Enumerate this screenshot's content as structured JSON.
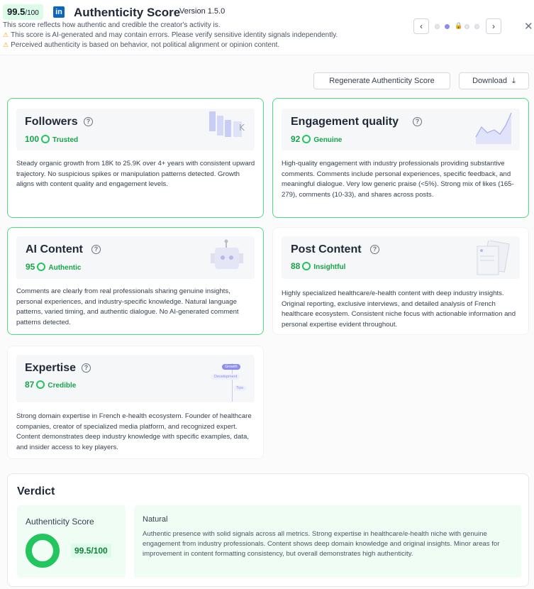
{
  "header": {
    "score": "99.5",
    "score_max": "/100",
    "linkedin_icon": "linkedin-icon",
    "title": "Authenticity Score",
    "version": "Version 1.5.0",
    "subtitle": "This score reflects how authentic and credible the creator's activity is.",
    "warnings": [
      "This score is AI-generated and may contain errors. Please verify sensitive identity signals independently.",
      "Perceived authenticity is based on behavior, not political alignment or opinion content."
    ],
    "pager": {
      "prev_icon": "chevron-left-icon",
      "next_icon": "chevron-right-icon",
      "active_dot": 2,
      "dot_count": 5
    },
    "close_icon": "close-icon"
  },
  "actions": {
    "regenerate_label": "Regenerate Authenticity Score",
    "download_label": "Download"
  },
  "colors": {
    "accent_green": "#22c55e",
    "pill_green": "#dcfce7",
    "linkedin_blue": "#0a66c2",
    "active_dot": "#8b8cf0"
  },
  "cards": {
    "followers": {
      "title": "Followers",
      "score": "100",
      "status": "Trusted",
      "description": "Steady organic growth from 18K to 25.9K over 4+ years with consistent upward trajectory. No suspicious spikes or manipulation patterns detected. Growth aligns with content quality and engagement levels."
    },
    "engagement": {
      "title": "Engagement quality",
      "score": "92",
      "status": "Genuine",
      "description": "High-quality engagement with industry professionals providing substantive comments. Comments include personal experiences, specific feedback, and meaningful dialogue. Very low generic praise (<5%). Strong mix of likes (165-279), comments (10-33), and shares across posts."
    },
    "ai_content": {
      "title": "AI Content",
      "score": "95",
      "status": "Authentic",
      "description": "Comments are clearly from real professionals sharing genuine insights, personal experiences, and industry-specific knowledge. Natural language patterns, varied timing, and authentic dialogue. No AI-generated comment patterns detected."
    },
    "post_content": {
      "title": "Post Content",
      "score": "88",
      "status": "Insightful",
      "description": "Highly specialized healthcare/e-health content with deep industry insights. Original reporting, exclusive interviews, and detailed analysis of French healthcare ecosystem. Consistent niche focus with actionable information and personal expertise evident throughout."
    },
    "expertise": {
      "title": "Expertise",
      "score": "87",
      "status": "Credible",
      "description": "Strong domain expertise in French e-health ecosystem. Founder of healthcare companies, creator of specialized media platform, and recognized expert. Content demonstrates deep industry knowledge with specific examples, data, and insider access to key players.",
      "tags": [
        "Growth",
        "Development",
        "Tips"
      ]
    }
  },
  "verdict": {
    "title": "Verdict",
    "score_label": "Authenticity Score",
    "score": "99.5/100",
    "score_fraction": 0.995,
    "label": "Natural",
    "description": "Authentic presence with solid signals across all metrics. Strong expertise in healthcare/e-health niche with genuine engagement from industry professionals. Content shows deep domain knowledge and original insights. Minor areas for improvement in content formatting consistency, but overall demonstrates high authenticity."
  }
}
